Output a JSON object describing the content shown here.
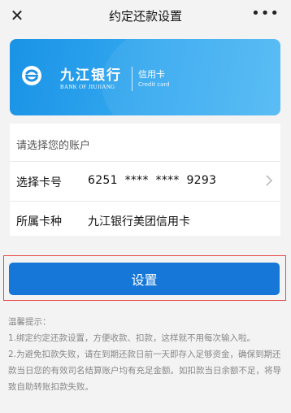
{
  "topbar": {
    "title": "约定还款设置",
    "close_icon": "close-icon",
    "more_icon": "more-icon",
    "close_glyph": "✕",
    "more_glyph": "•••"
  },
  "card": {
    "bank_name_cn": "九江银行",
    "bank_name_en": "BANK OF JIUJIANG",
    "product_cn": "信用卡",
    "product_en": "Credit card",
    "colors": {
      "from": "#1a93e6",
      "to": "#4fb8f4"
    }
  },
  "account": {
    "heading": "请选择您的账户",
    "card_no_label": "选择卡号",
    "card_no_value": "6251 **** **** 9293",
    "card_type_label": "所属卡种",
    "card_type_value": "九江银行美团信用卡"
  },
  "actions": {
    "set_label": "设置",
    "accent": "#1677d9",
    "highlight": "#e84a4a"
  },
  "tips": {
    "title": "温馨提示：",
    "items": [
      "1.绑定约定还款设置，方便收款、扣款，这样就不用每次输入啦。",
      "2.为避免扣款失败，请在到期还款日前一天即存入足够资金，确保到期还款当日您的有效司名结算账户均有充足金额。如扣款当日余额不足，将导致自助转账扣款失败。"
    ]
  }
}
